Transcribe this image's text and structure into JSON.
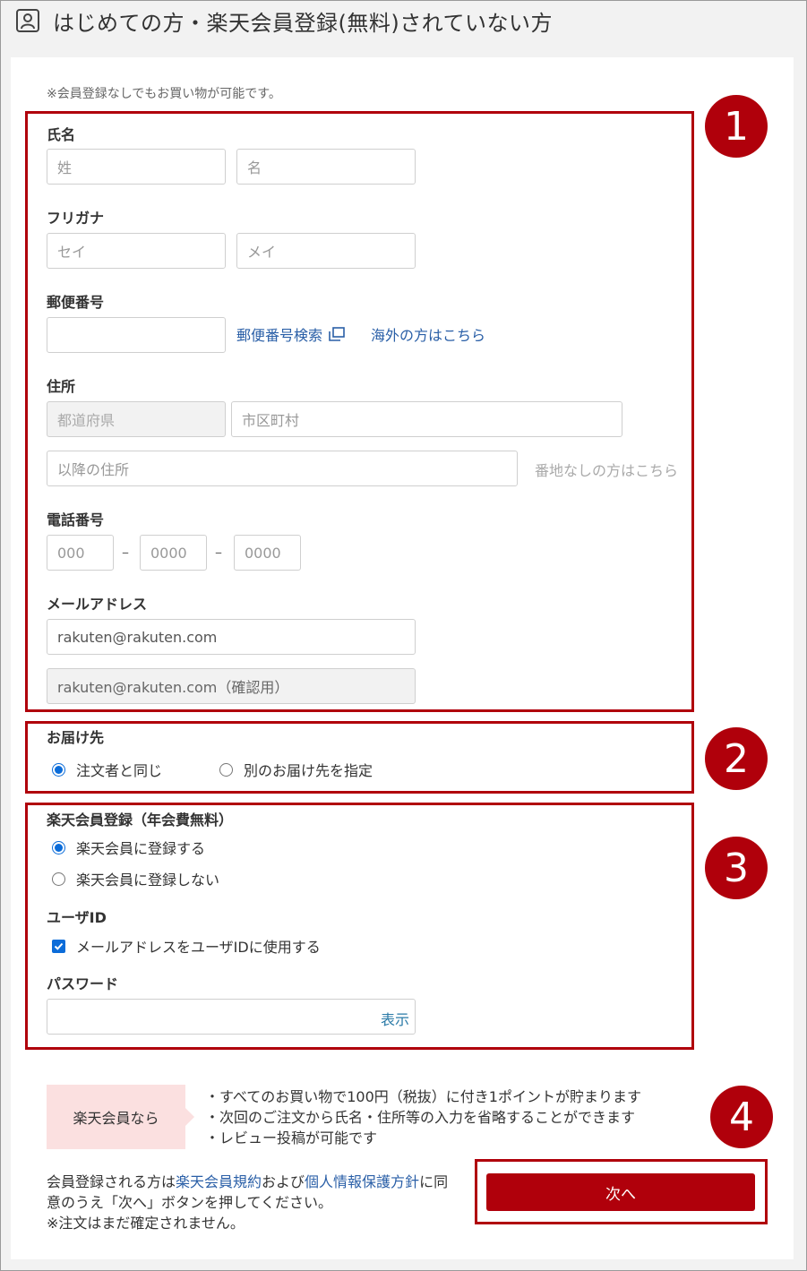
{
  "header": {
    "title": "はじめての方・楽天会員登録(無料)されていない方"
  },
  "note": "※会員登録なしでもお買い物が可能です。",
  "name": {
    "label": "氏名",
    "last_placeholder": "姓",
    "first_placeholder": "名"
  },
  "kana": {
    "label": "フリガナ",
    "last_placeholder": "セイ",
    "first_placeholder": "メイ"
  },
  "postal": {
    "label": "郵便番号",
    "value": "",
    "search_link": "郵便番号検索",
    "overseas_link": "海外の方はこちら"
  },
  "address": {
    "label": "住所",
    "prefecture_placeholder": "都道府県",
    "city_placeholder": "市区町村",
    "street_placeholder": "以降の住所",
    "no_number_link": "番地なしの方はこちら"
  },
  "phone": {
    "label": "電話番号",
    "part1_placeholder": "000",
    "part2_placeholder": "0000",
    "part3_placeholder": "0000",
    "separator": "–"
  },
  "email": {
    "label": "メールアドレス",
    "value": "rakuten@rakuten.com",
    "confirm_value": "rakuten@rakuten.com（確認用）"
  },
  "delivery": {
    "label": "お届け先",
    "options": [
      {
        "label": "注文者と同じ",
        "checked": true
      },
      {
        "label": "別のお届け先を指定",
        "checked": false
      }
    ]
  },
  "membership": {
    "label": "楽天会員登録（年会費無料）",
    "options": [
      {
        "label": "楽天会員に登録する",
        "checked": true
      },
      {
        "label": "楽天会員に登録しない",
        "checked": false
      }
    ]
  },
  "user_id": {
    "label": "ユーザID",
    "checkbox_label": "メールアドレスをユーザIDに使用する",
    "checked": true
  },
  "password": {
    "label": "パスワード",
    "value": "",
    "show_label": "表示"
  },
  "badges": [
    "1",
    "2",
    "3",
    "4"
  ],
  "promo": {
    "label": "楽天会員なら",
    "bullets": [
      "・すべてのお買い物で100円（税抜）に付き1ポイントが貯まります",
      "・次回のご注文から氏名・住所等の入力を省略することができます",
      "・レビュー投稿が可能です"
    ]
  },
  "terms": {
    "prefix": "会員登録される方は",
    "link1": "楽天会員規約",
    "middle": "および",
    "link2": "個人情報保護方針",
    "suffix_line1": "に同",
    "line2": "意のうえ「次へ」ボタンを押してください。",
    "line3": "※注文はまだ確定されません。"
  },
  "next_button": "次へ",
  "colors": {
    "accent_red": "#b0000b",
    "link_blue": "#2a5fa7",
    "radio_blue": "#0b6cd9",
    "promo_pink": "#fbe0e0"
  }
}
